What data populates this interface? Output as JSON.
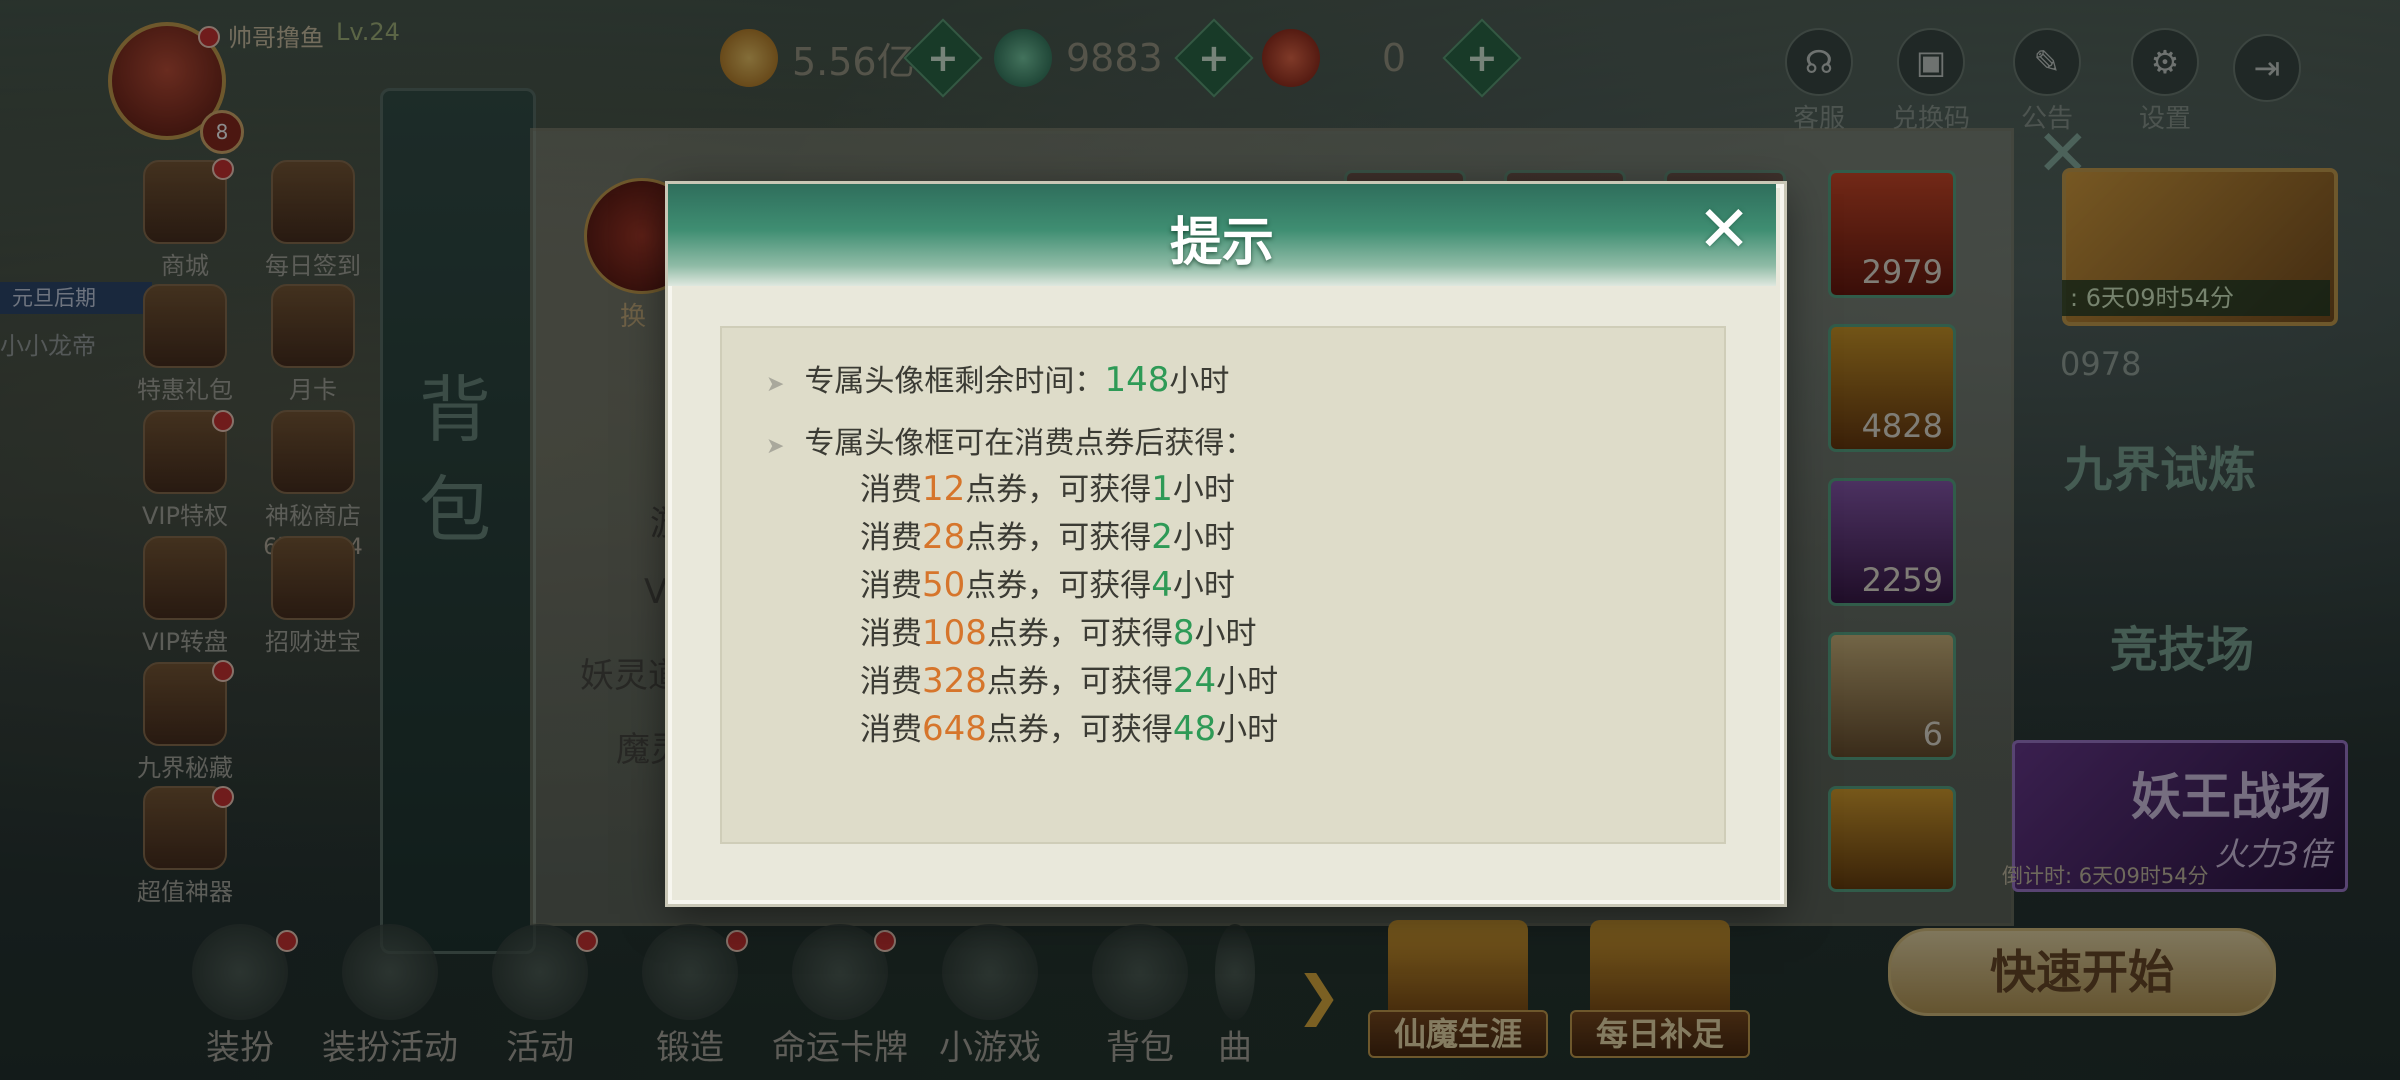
{
  "player": {
    "name": "帅哥撸鱼",
    "level": "Lv.24",
    "badge": "8"
  },
  "resources": [
    {
      "name": "gold",
      "value": "5.56亿",
      "color": "#d8a040"
    },
    {
      "name": "jade",
      "value": "9883",
      "color": "#3a9070"
    },
    {
      "name": "coupon",
      "value": "0",
      "color": "#c83a2a"
    }
  ],
  "top_buttons": [
    {
      "label": "客服",
      "icon": "headset-icon"
    },
    {
      "label": "兑换码",
      "icon": "redeem-icon"
    },
    {
      "label": "公告",
      "icon": "announce-icon"
    },
    {
      "label": "设置",
      "icon": "gear-icon"
    }
  ],
  "left_menu": [
    {
      "label": "商城"
    },
    {
      "label": "每日签到"
    },
    {
      "label": "特惠礼包"
    },
    {
      "label": "月卡"
    },
    {
      "label": "VIP特权"
    },
    {
      "label": "神秘商店",
      "sub": "6天09:54"
    },
    {
      "label": "VIP转盘"
    },
    {
      "label": "招财进宝"
    },
    {
      "label": "九界秘藏"
    },
    {
      "label": "超值神器"
    }
  ],
  "side_pill": "元旦后期",
  "side_name": "小小龙帝",
  "bag": {
    "title": "背包",
    "avatar_label": "换",
    "text_lines": [
      "游",
      "V",
      "妖灵道",
      "魔灵"
    ],
    "slots": [
      "2979",
      "4828",
      "2259",
      "6"
    ]
  },
  "right": {
    "timer": ": 6天09时54分",
    "number": "0978",
    "trial": "九界试炼",
    "arena": "竞技场",
    "yaowang": "妖王战场",
    "yaowang_sub": "火力3倍",
    "countdown": "倒计时: 6天09时54分",
    "quick_start": "快速开始"
  },
  "bottom_nav": [
    "装扮",
    "装扮活动",
    "活动",
    "锻造",
    "命运卡牌",
    "小游戏",
    "背包",
    "曲"
  ],
  "bottom_big": [
    "仙魔生涯",
    "每日补足"
  ],
  "dialog": {
    "title": "提示",
    "remaining_label": "专属头像框剩余时间：",
    "remaining_value": "148",
    "remaining_unit": "小时",
    "obtain_label": "专属头像框可在消费点券后获得：",
    "rows": [
      {
        "pre": "消费",
        "cost": "12",
        "mid": "点券，可获得",
        "hours": "1",
        "unit": "小时"
      },
      {
        "pre": "消费",
        "cost": "28",
        "mid": "点券，可获得",
        "hours": "2",
        "unit": "小时"
      },
      {
        "pre": "消费",
        "cost": "50",
        "mid": "点券，可获得",
        "hours": "4",
        "unit": "小时"
      },
      {
        "pre": "消费",
        "cost": "108",
        "mid": "点券，可获得",
        "hours": "8",
        "unit": "小时"
      },
      {
        "pre": "消费",
        "cost": "328",
        "mid": "点券，可获得",
        "hours": "24",
        "unit": "小时"
      },
      {
        "pre": "消费",
        "cost": "648",
        "mid": "点券，可获得",
        "hours": "48",
        "unit": "小时"
      }
    ]
  }
}
